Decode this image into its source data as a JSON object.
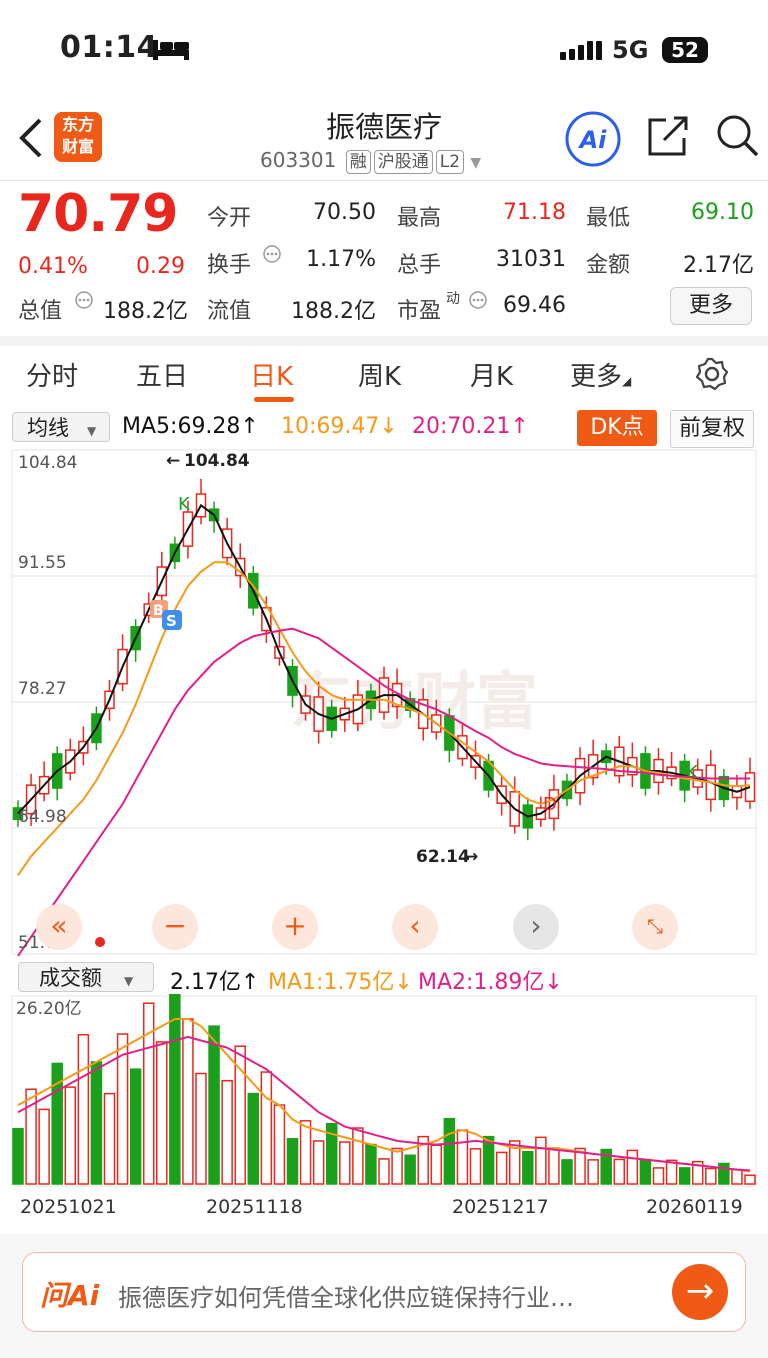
{
  "status": {
    "time": "01:14",
    "network": "5G",
    "battery": "52"
  },
  "header": {
    "logo_line1": "东方",
    "logo_line2": "财富",
    "title": "振德医疗",
    "code": "603301",
    "tags": [
      "融",
      "沪股通",
      "L2"
    ],
    "ai_label": "Ai"
  },
  "quote": {
    "price": "70.79",
    "change_pct": "0.41%",
    "change": "0.29",
    "rows": [
      [
        {
          "label": "今开",
          "value": "70.50",
          "color": "normal"
        },
        {
          "label": "最高",
          "value": "71.18",
          "color": "red"
        },
        {
          "label": "最低",
          "value": "69.10",
          "color": "green"
        }
      ],
      [
        {
          "label": "换手",
          "value": "1.17%",
          "color": "normal"
        },
        {
          "label": "总手",
          "value": "31031",
          "color": "normal"
        },
        {
          "label": "金额",
          "value": "2.17亿",
          "color": "normal"
        }
      ]
    ],
    "total_value_label": "总值",
    "total_value": "188.2亿",
    "float_value_label": "流值",
    "float_value": "188.2亿",
    "pe_label": "市盈",
    "pe_sup": "动",
    "pe_value": "69.46",
    "more": "更多"
  },
  "tabs": [
    {
      "label": "分时",
      "active": false
    },
    {
      "label": "五日",
      "active": false
    },
    {
      "label": "日K",
      "active": true
    },
    {
      "label": "周K",
      "active": false
    },
    {
      "label": "月K",
      "active": false
    },
    {
      "label": "更多",
      "active": false
    }
  ],
  "ma_bar": {
    "selector": "均线",
    "ma5": "MA5:69.28↑",
    "ma10": "10:69.47↓",
    "ma20": "20:70.21↑",
    "dk": "DK点",
    "fq": "前复权"
  },
  "kline": {
    "y_labels": [
      "104.84",
      "91.55",
      "78.27",
      "64.98",
      "51.70"
    ],
    "high_label": "104.84",
    "low_label": "62.14",
    "markers": {
      "k1": "K",
      "k2": "K",
      "d": "D",
      "b": "B",
      "s": "S"
    },
    "watermark": "东方财富"
  },
  "volume_bar": {
    "selector": "成交额",
    "value": "2.17亿↑",
    "ma1": "MA1:1.75亿↓",
    "ma2": "MA2:1.89亿↓",
    "top_label": "26.20亿"
  },
  "dates": [
    "20251021",
    "20251118",
    "20251217",
    "20260119"
  ],
  "ask": {
    "logo": "问Ai",
    "text": "振德医疗如何凭借全球化供应链保持行业…"
  },
  "colors": {
    "up": "#e8281e",
    "down": "#1aa01a",
    "accent": "#f05a14",
    "ma5": "#111111",
    "ma10": "#f59a1a",
    "ma20": "#e0208c"
  },
  "chart_data": {
    "type": "candlestick",
    "title": "",
    "y_range": [
      51.7,
      104.84
    ],
    "volume_max": 26.2,
    "series": [
      {
        "name": "MA5",
        "values": [
          66.5,
          68.0,
          69.5,
          71.0,
          72.0,
          73.5,
          75.5,
          78.5,
          82.0,
          85.0,
          88.0,
          91.0,
          94.0,
          96.5,
          99.0,
          98.0,
          95.0,
          92.5,
          90.0,
          87.0,
          83.5,
          80.5,
          78.0,
          77.0,
          76.5,
          77.0,
          77.5,
          78.5,
          79.0,
          79.0,
          78.0,
          77.0,
          76.0,
          75.0,
          73.5,
          72.0,
          70.5,
          68.5,
          67.0,
          66.2,
          66.5,
          67.5,
          69.0,
          70.5,
          71.5,
          72.5,
          72.0,
          71.5,
          71.0,
          71.0,
          70.8,
          70.5,
          70.2,
          69.8,
          69.2,
          68.8,
          69.3
        ]
      },
      {
        "name": "MA10",
        "values": [
          60.0,
          62.0,
          63.5,
          65.0,
          66.5,
          68.0,
          70.0,
          72.5,
          75.0,
          78.0,
          81.5,
          85.0,
          88.0,
          90.5,
          92.0,
          93.0,
          93.0,
          92.0,
          90.5,
          88.5,
          86.0,
          83.5,
          81.5,
          80.0,
          79.0,
          78.5,
          78.5,
          78.5,
          78.5,
          78.0,
          77.5,
          77.0,
          76.0,
          75.0,
          74.0,
          73.0,
          72.0,
          70.5,
          69.0,
          68.0,
          67.5,
          68.0,
          69.0,
          70.0,
          70.5,
          71.0,
          71.5,
          71.5,
          71.0,
          70.8,
          70.5,
          70.2,
          70.0,
          69.8,
          69.5,
          69.4,
          69.5
        ]
      },
      {
        "name": "MA20",
        "values": [
          51.5,
          53.5,
          55.5,
          57.5,
          59.5,
          61.5,
          63.5,
          65.5,
          67.5,
          70.0,
          72.5,
          75.0,
          77.5,
          79.5,
          81.0,
          82.5,
          83.5,
          84.5,
          85.2,
          85.5,
          85.8,
          86.0,
          85.5,
          85.0,
          84.0,
          83.0,
          82.0,
          81.0,
          80.0,
          79.2,
          78.5,
          78.0,
          77.5,
          76.8,
          76.0,
          75.2,
          74.5,
          73.5,
          72.8,
          72.3,
          71.8,
          71.6,
          71.5,
          71.4,
          71.3,
          71.2,
          71.0,
          70.9,
          70.8,
          70.6,
          70.5,
          70.4,
          70.3,
          70.2,
          70.2,
          70.2,
          70.2
        ]
      }
    ],
    "volume_series": [
      {
        "name": "MA1",
        "values": [
          11,
          12,
          13,
          14,
          15,
          16,
          17,
          18,
          19,
          20,
          21,
          22,
          23,
          23,
          22,
          20,
          18,
          16,
          14,
          12,
          11,
          9,
          8,
          7.5,
          7,
          6.5,
          6,
          5.5,
          5,
          4.5,
          5,
          5.5,
          6,
          7,
          7.5,
          7,
          6,
          5.5,
          5,
          5,
          5,
          5,
          4.8,
          4.5,
          4.2,
          4,
          3.8,
          3.6,
          3.4,
          3.2,
          3,
          2.8,
          2.6,
          2.4,
          2.2,
          2.0,
          1.75
        ]
      },
      {
        "name": "MA2",
        "values": [
          10,
          11,
          12,
          13,
          14,
          15,
          16,
          17,
          18,
          18.5,
          19,
          19.5,
          20,
          20.5,
          20,
          19.5,
          19,
          18,
          17,
          16,
          14.5,
          13,
          11.5,
          10,
          9,
          8,
          7.5,
          7,
          6.5,
          6,
          5.8,
          5.6,
          5.5,
          5.6,
          5.8,
          6,
          5.8,
          5.6,
          5.4,
          5.2,
          5,
          4.8,
          4.6,
          4.4,
          4.2,
          4,
          3.8,
          3.6,
          3.4,
          3.2,
          3,
          2.8,
          2.6,
          2.4,
          2.2,
          2.0,
          1.89
        ]
      }
    ]
  }
}
